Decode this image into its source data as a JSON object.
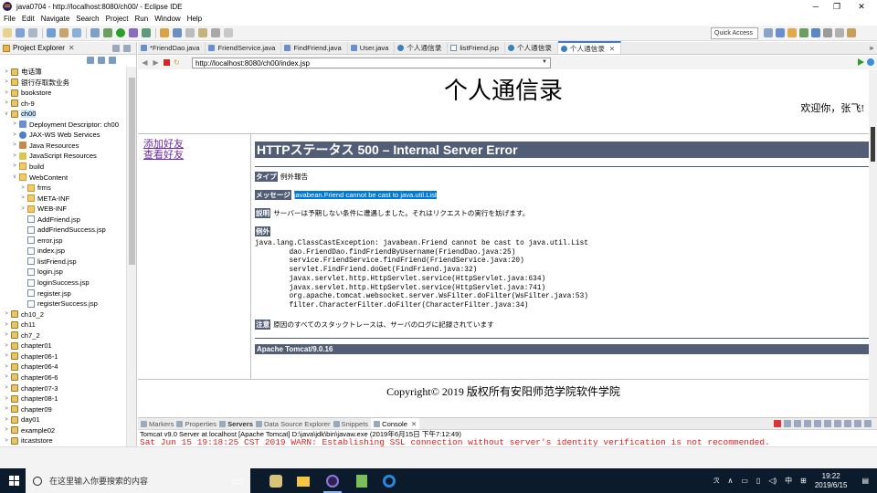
{
  "window": {
    "title": "java0704 - http://localhost:8080/ch00/ - Eclipse IDE",
    "minimize": "─",
    "maximize": "❐",
    "close": "✕"
  },
  "menu": [
    "File",
    "Edit",
    "Navigate",
    "Search",
    "Project",
    "Run",
    "Window",
    "Help"
  ],
  "toolbar": {
    "quick_access": "Quick Access"
  },
  "explorer": {
    "title": "Project Explorer",
    "close_glyph": "✕",
    "items": [
      {
        "label": "电话簿",
        "level": 0,
        "twisty": ">",
        "icon": "proj"
      },
      {
        "label": "银行存取款业务",
        "level": 0,
        "twisty": ">",
        "icon": "proj"
      },
      {
        "label": "bookstore",
        "level": 0,
        "twisty": ">",
        "icon": "proj"
      },
      {
        "label": "ch-9",
        "level": 0,
        "twisty": ">",
        "icon": "proj"
      },
      {
        "label": "ch00",
        "level": 0,
        "twisty": "v",
        "icon": "proj",
        "selected": true
      },
      {
        "label": "Deployment Descriptor: ch00",
        "level": 1,
        "twisty": ">",
        "icon": "desc"
      },
      {
        "label": "JAX-WS Web Services",
        "level": 1,
        "twisty": ">",
        "icon": "web"
      },
      {
        "label": "Java Resources",
        "level": 1,
        "twisty": ">",
        "icon": "jar"
      },
      {
        "label": "JavaScript Resources",
        "level": 1,
        "twisty": ">",
        "icon": "js"
      },
      {
        "label": "build",
        "level": 1,
        "twisty": ">",
        "icon": "folder"
      },
      {
        "label": "WebContent",
        "level": 1,
        "twisty": "v",
        "icon": "folder"
      },
      {
        "label": "frms",
        "level": 2,
        "twisty": ">",
        "icon": "folder"
      },
      {
        "label": "META-INF",
        "level": 2,
        "twisty": ">",
        "icon": "folder"
      },
      {
        "label": "WEB-INF",
        "level": 2,
        "twisty": ">",
        "icon": "folder"
      },
      {
        "label": "AddFriend.jsp",
        "level": 2,
        "twisty": "",
        "icon": "jsp"
      },
      {
        "label": "addFriendSuccess.jsp",
        "level": 2,
        "twisty": "",
        "icon": "jsp"
      },
      {
        "label": "error.jsp",
        "level": 2,
        "twisty": "",
        "icon": "jsp"
      },
      {
        "label": "index.jsp",
        "level": 2,
        "twisty": "",
        "icon": "jsp"
      },
      {
        "label": "listFriend.jsp",
        "level": 2,
        "twisty": "",
        "icon": "jsp"
      },
      {
        "label": "login.jsp",
        "level": 2,
        "twisty": "",
        "icon": "jsp"
      },
      {
        "label": "loginSuccess.jsp",
        "level": 2,
        "twisty": "",
        "icon": "jsp"
      },
      {
        "label": "register.jsp",
        "level": 2,
        "twisty": "",
        "icon": "jsp"
      },
      {
        "label": "registerSuccess.jsp",
        "level": 2,
        "twisty": "",
        "icon": "jsp"
      },
      {
        "label": "ch10_2",
        "level": 0,
        "twisty": ">",
        "icon": "proj"
      },
      {
        "label": "ch11",
        "level": 0,
        "twisty": ">",
        "icon": "proj"
      },
      {
        "label": "ch7_2",
        "level": 0,
        "twisty": ">",
        "icon": "proj"
      },
      {
        "label": "chapter01",
        "level": 0,
        "twisty": ">",
        "icon": "proj"
      },
      {
        "label": "chapter06-1",
        "level": 0,
        "twisty": ">",
        "icon": "proj"
      },
      {
        "label": "chapter06-4",
        "level": 0,
        "twisty": ">",
        "icon": "proj"
      },
      {
        "label": "chapter06-6",
        "level": 0,
        "twisty": ">",
        "icon": "proj"
      },
      {
        "label": "chapter07-3",
        "level": 0,
        "twisty": ">",
        "icon": "proj"
      },
      {
        "label": "chapter08-1",
        "level": 0,
        "twisty": ">",
        "icon": "proj"
      },
      {
        "label": "chapter09",
        "level": 0,
        "twisty": ">",
        "icon": "proj"
      },
      {
        "label": "day01",
        "level": 0,
        "twisty": ">",
        "icon": "proj"
      },
      {
        "label": "example02",
        "level": 0,
        "twisty": ">",
        "icon": "proj"
      },
      {
        "label": "itcaststore",
        "level": 0,
        "twisty": ">",
        "icon": "proj"
      }
    ]
  },
  "editor": {
    "tabs": [
      {
        "label": "*FriendDao.java",
        "icon": "java"
      },
      {
        "label": "FriendService.java",
        "icon": "java"
      },
      {
        "label": "FindFriend.java",
        "icon": "java"
      },
      {
        "label": "User.java",
        "icon": "java"
      },
      {
        "label": "个人通信录",
        "icon": "globe"
      },
      {
        "label": "listFriend.jsp",
        "icon": "jsp"
      },
      {
        "label": "个人通信录",
        "icon": "globe"
      },
      {
        "label": "个人通信录",
        "icon": "globe",
        "active": true
      }
    ],
    "tab_close": "✕",
    "more_glyph": "»",
    "url": "http://localhost:8080/ch00/index.jsp"
  },
  "page": {
    "title": "个人通信录",
    "welcome": "欢迎你，张飞!",
    "nav_links": [
      "添加好友",
      "查看好友"
    ],
    "error_title": "HTTPステータス 500 – Internal Server Error",
    "type_label": "タイプ",
    "type_value": "例外報告",
    "message_label": "メッセージ",
    "message_value": "javabean.Friend cannot be cast to java.util.List",
    "desc_label": "説明",
    "desc_value": "サーバーは予期しない条件に遭遇しました。それはリクエストの実行を妨げます。",
    "exception_label": "例外",
    "stack_trace": "java.lang.ClassCastException: javabean.Friend cannot be cast to java.util.List\n\tdao.FriendDao.findFriendByUsername(FriendDao.java:25)\n\tservice.FriendService.findFriend(FriendService.java:20)\n\tservlet.FindFriend.doGet(FindFriend.java:32)\n\tjavax.servlet.http.HttpServlet.service(HttpServlet.java:634)\n\tjavax.servlet.http.HttpServlet.service(HttpServlet.java:741)\n\torg.apache.tomcat.websocket.server.WsFilter.doFilter(WsFilter.java:53)\n\tfilter.CharacterFilter.doFilter(CharacterFilter.java:34)",
    "note_label": "注意",
    "note_value": "原因のすべてのスタックトレースは、サーバのログに記録されています",
    "footer": "Apache Tomcat/9.0.16",
    "copyright": "Copyright© 2019 版权所有安阳师范学院软件学院"
  },
  "console": {
    "tabs": [
      "Markers",
      "Properties",
      "Servers",
      "Data Source Explorer",
      "Snippets",
      "Console"
    ],
    "active_tab": "Console",
    "description": "Tomcat v9.0 Server at localhost [Apache Tomcat] D:\\java\\jdk\\bin\\javaw.exe (2019年6月15日 下午7:12:49)",
    "output": "Sat Jun 15 19:18:25 CST 2019 WARN: Establishing SSL connection without server's identity verification is not recommended."
  },
  "taskbar": {
    "search_placeholder": "在这里输入你要搜索的内容",
    "tray_person": "ℛ",
    "tray_input": "中",
    "tray_time": "19:22",
    "tray_date": "2019/6/15"
  },
  "colors": {
    "tomcat_header": "#525d76",
    "visited_link": "#6a2aa0",
    "console_error": "#dd2222",
    "selection": "#0078d7"
  }
}
